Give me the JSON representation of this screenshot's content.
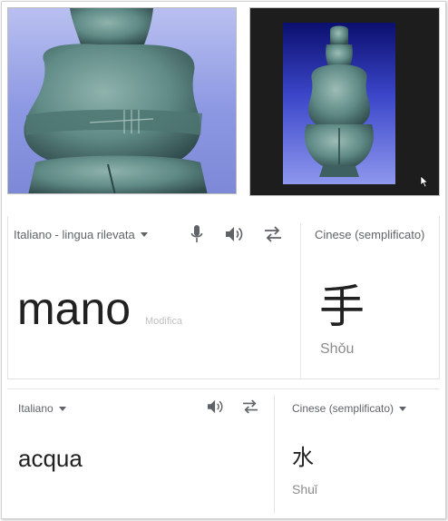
{
  "panel1": {
    "source_lang": "Italiano - lingua rilevata",
    "target_lang": "Cinese (semplificato)",
    "source_text": "mano",
    "edit_label": "Modifica",
    "translation": "手",
    "pinyin": "Shǒu"
  },
  "panel2": {
    "source_lang": "Italiano",
    "target_lang": "Cinese (semplificato)",
    "source_text": "acqua",
    "translation": "水",
    "pinyin": "Shuǐ"
  },
  "colors": {
    "icon_gray": "#5f6368",
    "text_dark": "#212121",
    "pinyin_gray": "#8c8c8c",
    "photo_left_bg": "#8c98e2",
    "photo_right_bg": "#1d1d1d",
    "statue_green": "#5f8a86"
  },
  "icons": [
    "microphone-icon",
    "speaker-icon",
    "swap-icon",
    "cursor-icon"
  ]
}
